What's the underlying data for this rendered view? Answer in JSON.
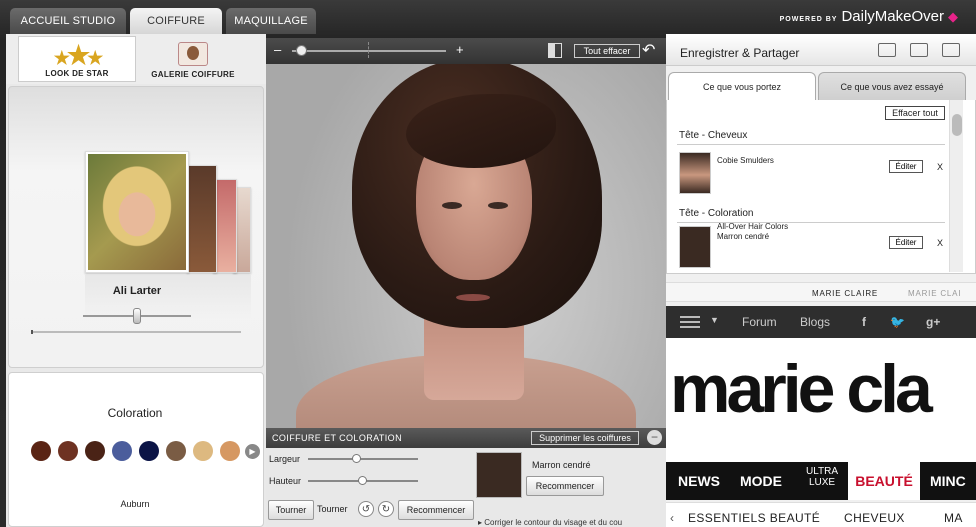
{
  "top_tabs": [
    "ACCUEIL STUDIO",
    "COIFFURE",
    "MAQUILLAGE"
  ],
  "brand": {
    "powered_by": "POWERED BY",
    "name": "DailyMakeOver"
  },
  "left": {
    "subtabs": [
      "LOOK DE STAR",
      "GALERIE COIFFURE"
    ],
    "star_name": "Ali Larter",
    "coloration_title": "Coloration",
    "swatches": [
      "#5a2414",
      "#6e3222",
      "#4a2316",
      "#4b5d9c",
      "#0b1446",
      "#7a5c44",
      "#ddb980",
      "#d69862"
    ],
    "selected_color": "Auburn"
  },
  "center": {
    "zoom_minus": "–",
    "zoom_plus": "+",
    "clear_all": "Tout effacer",
    "panel_title": "COIFFURE ET COLORATION",
    "remove_hair": "Supprimer les coiffures",
    "largeur": "Largeur",
    "hauteur": "Hauteur",
    "tourner_btn": "Tourner",
    "tourner_label": "Tourner",
    "restart": "Recommencer",
    "hint": "Corriger le contour du visage et du cou",
    "color_name": "Marron cendré",
    "restart2": "Recommencer"
  },
  "right": {
    "share_title": "Enregistrer & Partager",
    "tab_wearing": "Ce que vous portez",
    "tab_tried": "Ce que vous avez essayé",
    "clear_all": "Effacer tout",
    "sections": [
      {
        "heading": "Tête - Cheveux",
        "item": "Cobie Smulders",
        "edit": "Éditer",
        "remove": "X"
      },
      {
        "heading": "Tête - Coloration",
        "item": "All-Over Hair Colors",
        "item2": "Marron cendré",
        "edit": "Éditer",
        "remove": "X"
      }
    ],
    "mc_links": [
      "MARIE CLAIRE",
      "MARIE CLAI"
    ],
    "mc_nav": [
      "Forum",
      "Blogs"
    ],
    "mc_logo": "marie cla",
    "mc_menu": [
      "NEWS",
      "MODE",
      "ULTRA LUXE",
      "BEAUTÉ",
      "MINC"
    ],
    "mc_sub": [
      "ESSENTIELS BEAUTÉ",
      "CHEVEUX",
      "MA"
    ]
  }
}
